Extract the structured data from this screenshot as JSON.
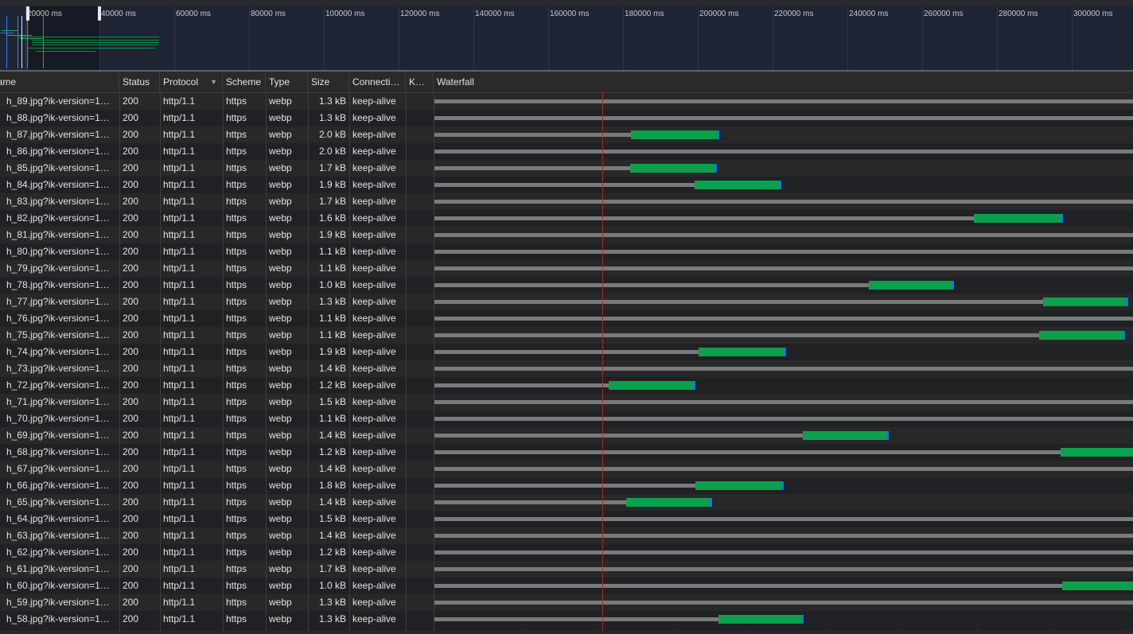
{
  "overview": {
    "tick_labels": [
      "20000 ms",
      "40000 ms",
      "60000 ms",
      "80000 ms",
      "100000 ms",
      "120000 ms",
      "140000 ms",
      "160000 ms",
      "180000 ms",
      "200000 ms",
      "220000 ms",
      "240000 ms",
      "260000 ms",
      "280000 ms",
      "300000 ms"
    ]
  },
  "columns": {
    "name": "Name",
    "status": "Status",
    "protocol": "Protocol",
    "scheme": "Scheme",
    "type": "Type",
    "size": "Size",
    "connection": "Connecti…",
    "connection_id": "K…",
    "waterfall": "Waterfall"
  },
  "colors": {
    "queued": "#7a7a7a",
    "download": "#0ba14c",
    "download_end": "#1a73e8",
    "load_line": "#a52a2a"
  },
  "rows": [
    {
      "name": "h_89.jpg?ik-version=1…",
      "status": "200",
      "protocol": "http/1.1",
      "scheme": "https",
      "type": "webp",
      "size": "1.3 kB",
      "connection": "keep-alive"
    },
    {
      "name": "h_88.jpg?ik-version=1…",
      "status": "200",
      "protocol": "http/1.1",
      "scheme": "https",
      "type": "webp",
      "size": "1.3 kB",
      "connection": "keep-alive"
    },
    {
      "name": "h_87.jpg?ik-version=1…",
      "status": "200",
      "protocol": "http/1.1",
      "scheme": "https",
      "type": "webp",
      "size": "2.0 kB",
      "connection": "keep-alive"
    },
    {
      "name": "h_86.jpg?ik-version=1…",
      "status": "200",
      "protocol": "http/1.1",
      "scheme": "https",
      "type": "webp",
      "size": "2.0 kB",
      "connection": "keep-alive"
    },
    {
      "name": "h_85.jpg?ik-version=1…",
      "status": "200",
      "protocol": "http/1.1",
      "scheme": "https",
      "type": "webp",
      "size": "1.7 kB",
      "connection": "keep-alive"
    },
    {
      "name": "h_84.jpg?ik-version=1…",
      "status": "200",
      "protocol": "http/1.1",
      "scheme": "https",
      "type": "webp",
      "size": "1.9 kB",
      "connection": "keep-alive"
    },
    {
      "name": "h_83.jpg?ik-version=1…",
      "status": "200",
      "protocol": "http/1.1",
      "scheme": "https",
      "type": "webp",
      "size": "1.7 kB",
      "connection": "keep-alive"
    },
    {
      "name": "h_82.jpg?ik-version=1…",
      "status": "200",
      "protocol": "http/1.1",
      "scheme": "https",
      "type": "webp",
      "size": "1.6 kB",
      "connection": "keep-alive"
    },
    {
      "name": "h_81.jpg?ik-version=1…",
      "status": "200",
      "protocol": "http/1.1",
      "scheme": "https",
      "type": "webp",
      "size": "1.9 kB",
      "connection": "keep-alive"
    },
    {
      "name": "h_80.jpg?ik-version=1…",
      "status": "200",
      "protocol": "http/1.1",
      "scheme": "https",
      "type": "webp",
      "size": "1.1 kB",
      "connection": "keep-alive"
    },
    {
      "name": "h_79.jpg?ik-version=1…",
      "status": "200",
      "protocol": "http/1.1",
      "scheme": "https",
      "type": "webp",
      "size": "1.1 kB",
      "connection": "keep-alive"
    },
    {
      "name": "h_78.jpg?ik-version=1…",
      "status": "200",
      "protocol": "http/1.1",
      "scheme": "https",
      "type": "webp",
      "size": "1.0 kB",
      "connection": "keep-alive"
    },
    {
      "name": "h_77.jpg?ik-version=1…",
      "status": "200",
      "protocol": "http/1.1",
      "scheme": "https",
      "type": "webp",
      "size": "1.3 kB",
      "connection": "keep-alive"
    },
    {
      "name": "h_76.jpg?ik-version=1…",
      "status": "200",
      "protocol": "http/1.1",
      "scheme": "https",
      "type": "webp",
      "size": "1.1 kB",
      "connection": "keep-alive"
    },
    {
      "name": "h_75.jpg?ik-version=1…",
      "status": "200",
      "protocol": "http/1.1",
      "scheme": "https",
      "type": "webp",
      "size": "1.1 kB",
      "connection": "keep-alive"
    },
    {
      "name": "h_74.jpg?ik-version=1…",
      "status": "200",
      "protocol": "http/1.1",
      "scheme": "https",
      "type": "webp",
      "size": "1.9 kB",
      "connection": "keep-alive"
    },
    {
      "name": "h_73.jpg?ik-version=1…",
      "status": "200",
      "protocol": "http/1.1",
      "scheme": "https",
      "type": "webp",
      "size": "1.4 kB",
      "connection": "keep-alive"
    },
    {
      "name": "h_72.jpg?ik-version=1…",
      "status": "200",
      "protocol": "http/1.1",
      "scheme": "https",
      "type": "webp",
      "size": "1.2 kB",
      "connection": "keep-alive"
    },
    {
      "name": "h_71.jpg?ik-version=1…",
      "status": "200",
      "protocol": "http/1.1",
      "scheme": "https",
      "type": "webp",
      "size": "1.5 kB",
      "connection": "keep-alive"
    },
    {
      "name": "h_70.jpg?ik-version=1…",
      "status": "200",
      "protocol": "http/1.1",
      "scheme": "https",
      "type": "webp",
      "size": "1.1 kB",
      "connection": "keep-alive"
    },
    {
      "name": "h_69.jpg?ik-version=1…",
      "status": "200",
      "protocol": "http/1.1",
      "scheme": "https",
      "type": "webp",
      "size": "1.4 kB",
      "connection": "keep-alive"
    },
    {
      "name": "h_68.jpg?ik-version=1…",
      "status": "200",
      "protocol": "http/1.1",
      "scheme": "https",
      "type": "webp",
      "size": "1.2 kB",
      "connection": "keep-alive"
    },
    {
      "name": "h_67.jpg?ik-version=1…",
      "status": "200",
      "protocol": "http/1.1",
      "scheme": "https",
      "type": "webp",
      "size": "1.4 kB",
      "connection": "keep-alive"
    },
    {
      "name": "h_66.jpg?ik-version=1…",
      "status": "200",
      "protocol": "http/1.1",
      "scheme": "https",
      "type": "webp",
      "size": "1.8 kB",
      "connection": "keep-alive"
    },
    {
      "name": "h_65.jpg?ik-version=1…",
      "status": "200",
      "protocol": "http/1.1",
      "scheme": "https",
      "type": "webp",
      "size": "1.4 kB",
      "connection": "keep-alive"
    },
    {
      "name": "h_64.jpg?ik-version=1…",
      "status": "200",
      "protocol": "http/1.1",
      "scheme": "https",
      "type": "webp",
      "size": "1.5 kB",
      "connection": "keep-alive"
    },
    {
      "name": "h_63.jpg?ik-version=1…",
      "status": "200",
      "protocol": "http/1.1",
      "scheme": "https",
      "type": "webp",
      "size": "1.4 kB",
      "connection": "keep-alive"
    },
    {
      "name": "h_62.jpg?ik-version=1…",
      "status": "200",
      "protocol": "http/1.1",
      "scheme": "https",
      "type": "webp",
      "size": "1.2 kB",
      "connection": "keep-alive"
    },
    {
      "name": "h_61.jpg?ik-version=1…",
      "status": "200",
      "protocol": "http/1.1",
      "scheme": "https",
      "type": "webp",
      "size": "1.7 kB",
      "connection": "keep-alive"
    },
    {
      "name": "h_60.jpg?ik-version=1…",
      "status": "200",
      "protocol": "http/1.1",
      "scheme": "https",
      "type": "webp",
      "size": "1.0 kB",
      "connection": "keep-alive"
    },
    {
      "name": "h_59.jpg?ik-version=1…",
      "status": "200",
      "protocol": "http/1.1",
      "scheme": "https",
      "type": "webp",
      "size": "1.3 kB",
      "connection": "keep-alive"
    },
    {
      "name": "h_58.jpg?ik-version=1…",
      "status": "200",
      "protocol": "http/1.1",
      "scheme": "https",
      "type": "webp",
      "size": "1.3 kB",
      "connection": "keep-alive"
    }
  ]
}
